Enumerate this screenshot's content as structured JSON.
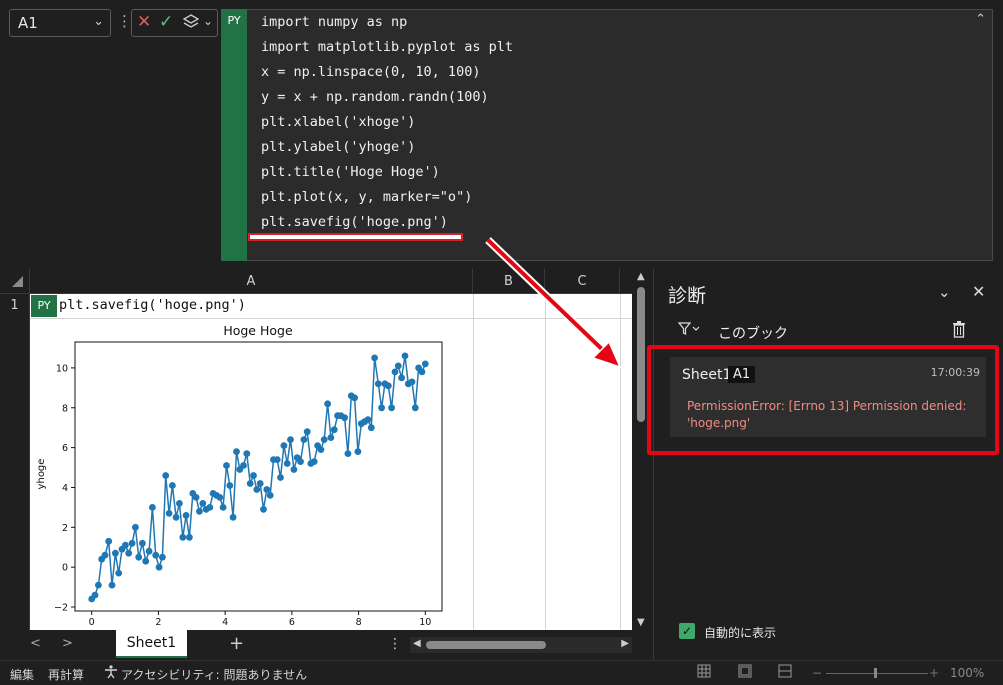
{
  "formula_bar": {
    "name_box": "A1",
    "cancel_icon": "✕",
    "enter_icon": "✓",
    "py_badge": "PY",
    "code_lines": [
      "import numpy as np",
      "import matplotlib.pyplot as plt",
      "x = np.linspace(0, 10, 100)",
      "y = x + np.random.randn(100)",
      "plt.xlabel('xhoge')",
      "plt.ylabel('yhoge')",
      "plt.title('Hoge Hoge')",
      "plt.plot(x, y, marker=\"o\")",
      "plt.savefig('hoge.png')"
    ]
  },
  "grid": {
    "columns": [
      "A",
      "B",
      "C"
    ],
    "row_number": "1",
    "py_badge": "PY",
    "cell_a1": "plt.savefig('hoge.png')"
  },
  "sheet_tabs": {
    "active": "Sheet1",
    "add": "+"
  },
  "status_bar": {
    "mode": "編集",
    "recalc": "再計算",
    "accessibility": "アクセシビリティ: 問題ありません",
    "zoom": "100%"
  },
  "diagnostics": {
    "title": "診断",
    "scope": "このブック",
    "entry": {
      "sheet": "Sheet1",
      "cell": "A1",
      "time": "17:00:39",
      "message": "PermissionError: [Errno 13] Permission denied: 'hoge.png'"
    },
    "auto_show_label": "自動的に表示",
    "auto_show_checked": true
  },
  "colors": {
    "excel_green": "#217346",
    "annotation_red": "#e30613",
    "error_text": "#f28b82",
    "series": "#1f77b4"
  },
  "chart_data": {
    "type": "line",
    "title": "Hoge Hoge",
    "xlabel": "",
    "ylabel": "yhoge",
    "xlim": [
      -0.5,
      10.5
    ],
    "ylim": [
      -2.2,
      11.3
    ],
    "xticks": [
      0,
      2,
      4,
      6,
      8,
      10
    ],
    "yticks": [
      -2,
      0,
      2,
      4,
      6,
      8,
      10
    ],
    "marker": "o",
    "series": [
      {
        "x": [
          0.0,
          0.1,
          0.2,
          0.3,
          0.4,
          0.51,
          0.61,
          0.71,
          0.81,
          0.91,
          1.01,
          1.11,
          1.21,
          1.31,
          1.41,
          1.52,
          1.62,
          1.72,
          1.82,
          1.92,
          2.02,
          2.12,
          2.22,
          2.32,
          2.42,
          2.53,
          2.63,
          2.73,
          2.83,
          2.93,
          3.03,
          3.13,
          3.23,
          3.33,
          3.43,
          3.54,
          3.64,
          3.74,
          3.84,
          3.94,
          4.04,
          4.14,
          4.24,
          4.34,
          4.44,
          4.55,
          4.65,
          4.75,
          4.85,
          4.95,
          5.05,
          5.15,
          5.25,
          5.35,
          5.45,
          5.56,
          5.66,
          5.76,
          5.86,
          5.96,
          6.06,
          6.16,
          6.26,
          6.36,
          6.46,
          6.57,
          6.67,
          6.77,
          6.87,
          6.97,
          7.07,
          7.17,
          7.27,
          7.37,
          7.47,
          7.58,
          7.68,
          7.78,
          7.88,
          7.98,
          8.08,
          8.18,
          8.28,
          8.38,
          8.48,
          8.59,
          8.69,
          8.79,
          8.89,
          8.99,
          9.09,
          9.19,
          9.29,
          9.39,
          9.49,
          9.6,
          9.7,
          9.8,
          9.9,
          10.0
        ],
        "values": [
          -1.6,
          -1.4,
          -0.9,
          0.4,
          0.6,
          1.3,
          -0.9,
          0.7,
          -0.3,
          0.9,
          1.1,
          0.7,
          1.2,
          2.0,
          0.5,
          1.2,
          0.3,
          0.8,
          3.0,
          0.6,
          0.0,
          0.5,
          4.6,
          2.7,
          4.1,
          2.5,
          3.2,
          1.5,
          2.6,
          1.5,
          3.7,
          3.5,
          2.8,
          3.2,
          2.9,
          3.0,
          3.7,
          3.6,
          3.5,
          3.0,
          5.1,
          4.1,
          2.5,
          5.8,
          4.9,
          5.1,
          5.7,
          4.2,
          4.6,
          3.9,
          4.2,
          2.9,
          3.9,
          3.6,
          5.4,
          5.4,
          4.5,
          6.1,
          5.2,
          6.4,
          4.9,
          5.5,
          5.3,
          6.4,
          6.8,
          5.2,
          5.3,
          6.1,
          5.9,
          6.4,
          8.2,
          6.5,
          6.9,
          7.6,
          7.6,
          7.5,
          5.7,
          8.6,
          8.5,
          5.8,
          7.2,
          7.3,
          7.4,
          7.0,
          10.5,
          9.2,
          8.0,
          9.2,
          9.1,
          8.0,
          9.8,
          10.1,
          9.5,
          10.6,
          9.2,
          9.3,
          8.0,
          10.0,
          9.8,
          10.2
        ]
      }
    ]
  }
}
